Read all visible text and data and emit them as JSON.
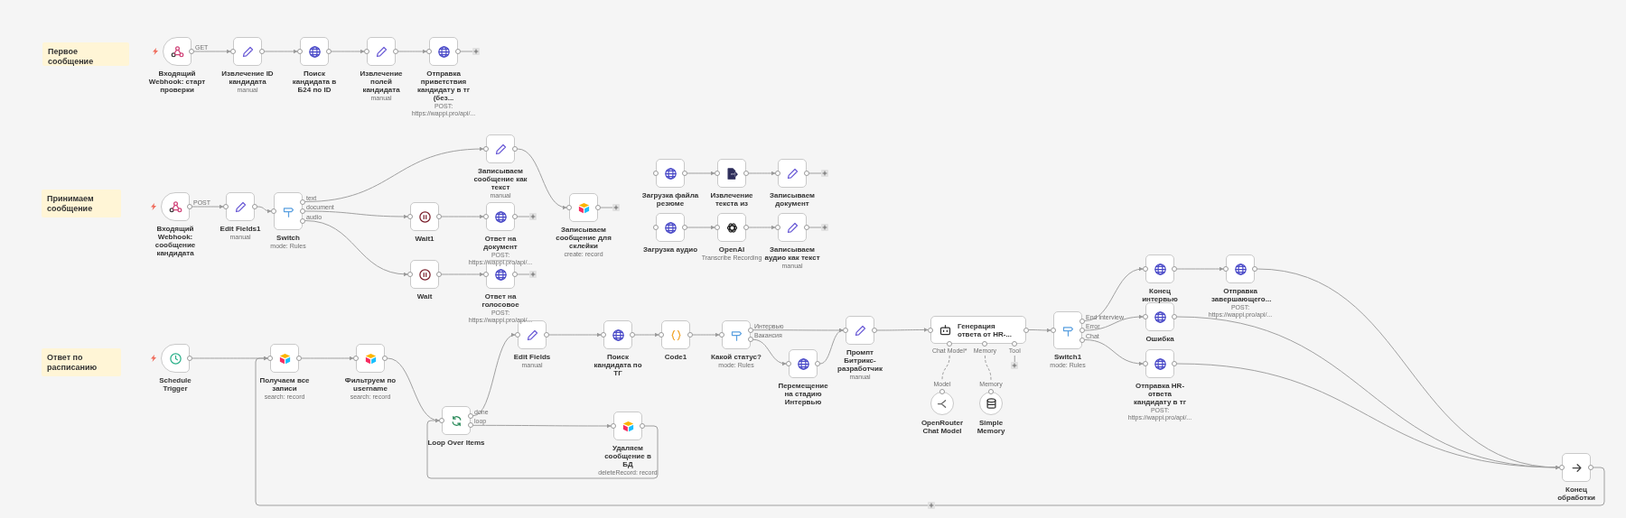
{
  "sticky_notes": [
    {
      "text": "Первое сообщение"
    },
    {
      "text": "Принимаем сообщение"
    },
    {
      "text": "Ответ по расписанию"
    }
  ],
  "nodes": [
    {
      "kind": "webhook",
      "label": "Входящий Webhook: старт проверки",
      "trigger": true,
      "outputs": [
        "GET"
      ]
    },
    {
      "kind": "edit",
      "label": "Извлечение ID кандидата",
      "subtitle": "manual",
      "trigger": false
    },
    {
      "kind": "http",
      "label": "Поиск кандидата в Б24 по ID",
      "trigger": false
    },
    {
      "kind": "edit",
      "label": "Извлечение полей кандидата",
      "subtitle": "manual",
      "trigger": false
    },
    {
      "kind": "http",
      "label": "Отправка приветствия кандидату в тг (без...",
      "subtitle": "POST: https://wappi.pro/api/...",
      "trigger": false
    },
    {
      "kind": "webhook",
      "label": "Входящий Webhook: сообщение кандидата",
      "trigger": true,
      "outputs": [
        "POST"
      ]
    },
    {
      "kind": "edit",
      "label": "Edit Fields1",
      "subtitle": "manual",
      "trigger": false
    },
    {
      "kind": "switch",
      "label": "Switch",
      "subtitle": "mode: Rules",
      "trigger": false,
      "outputs": [
        "text",
        "document",
        "audio"
      ]
    },
    {
      "kind": "edit",
      "label": "Записываем сообщение как текст",
      "subtitle": "manual",
      "trigger": false
    },
    {
      "kind": "wait",
      "label": "Wait1",
      "trigger": false
    },
    {
      "kind": "http",
      "label": "Ответ на документ",
      "subtitle": "POST: https://wappi.pro/api/...",
      "trigger": false
    },
    {
      "kind": "airtable",
      "label": "Записываем сообщение для склейки",
      "subtitle": "create: record",
      "trigger": false
    },
    {
      "kind": "wait",
      "label": "Wait",
      "trigger": false
    },
    {
      "kind": "http",
      "label": "Ответ на голосовое",
      "subtitle": "POST: https://wappi.pro/api/...",
      "trigger": false
    },
    {
      "kind": "http",
      "label": "Загрузка файла резюме",
      "trigger": false
    },
    {
      "kind": "extract",
      "label": "Извлечение текста из",
      "trigger": false
    },
    {
      "kind": "edit",
      "label": "Записываем документ",
      "trigger": false
    },
    {
      "kind": "http",
      "label": "Загрузка аудио",
      "trigger": false
    },
    {
      "kind": "openai",
      "label": "OpenAI",
      "subtitle": "Transcribe Recording",
      "trigger": false
    },
    {
      "kind": "edit",
      "label": "Записываем аудио как текст",
      "subtitle": "manual",
      "trigger": false
    },
    {
      "kind": "schedule",
      "label": "Schedule Trigger",
      "trigger": true
    },
    {
      "kind": "airtable",
      "label": "Получаем все записи",
      "subtitle": "search: record",
      "trigger": false
    },
    {
      "kind": "airtable",
      "label": "Фильтруем по username",
      "subtitle": "search: record",
      "trigger": false
    },
    {
      "kind": "loop",
      "label": "Loop Over Items",
      "trigger": false,
      "outputs": [
        "done",
        "loop"
      ]
    },
    {
      "kind": "edit",
      "label": "Edit Fields",
      "subtitle": "manual",
      "trigger": false
    },
    {
      "kind": "http",
      "label": "Поиск кандидата по ТГ",
      "trigger": false
    },
    {
      "kind": "code",
      "label": "Code1",
      "trigger": false
    },
    {
      "kind": "airtable",
      "label": "Удаляем сообщение в БД",
      "subtitle": "deleteRecord: record",
      "trigger": false
    },
    {
      "kind": "switch",
      "label": "Какой статус?",
      "subtitle": "mode: Rules",
      "trigger": false,
      "outputs": [
        "Интервью",
        "Вакансия"
      ]
    },
    {
      "kind": "http",
      "label": "Перемещение на стадию Интервью",
      "trigger": false
    },
    {
      "kind": "edit",
      "label": "Промпт Битрикс-разработчик",
      "subtitle": "manual",
      "trigger": false
    },
    {
      "kind": "agent",
      "label": "Генерация ответа от HR-...",
      "trigger": false,
      "inputs": [
        {
          "label": "Chat Model*"
        },
        {
          "label": "Memory"
        },
        {
          "label": "Tool"
        }
      ]
    },
    {
      "kind": "openrouter",
      "label": "OpenRouter Chat Model",
      "port_label": "Model",
      "trigger": false
    },
    {
      "kind": "memory",
      "label": "Simple Memory",
      "port_label": "Memory",
      "trigger": false
    },
    {
      "kind": "switch",
      "label": "Switch1",
      "subtitle": "mode: Rules",
      "trigger": false,
      "outputs": [
        "End interview",
        "Error",
        "Chat"
      ]
    },
    {
      "kind": "http",
      "label": "Конец интервью",
      "trigger": false
    },
    {
      "kind": "http",
      "label": "Отправка завершающего...",
      "subtitle": "POST: https://wappi.pro/api/...",
      "trigger": false
    },
    {
      "kind": "http",
      "label": "Ошибка",
      "trigger": false
    },
    {
      "kind": "http",
      "label": "Отправка HR-ответа кандидату в тг",
      "subtitle": "POST: https://wappi.pro/api/...",
      "trigger": false
    },
    {
      "kind": "noop",
      "label": "Конец обработки",
      "trigger": false
    }
  ]
}
